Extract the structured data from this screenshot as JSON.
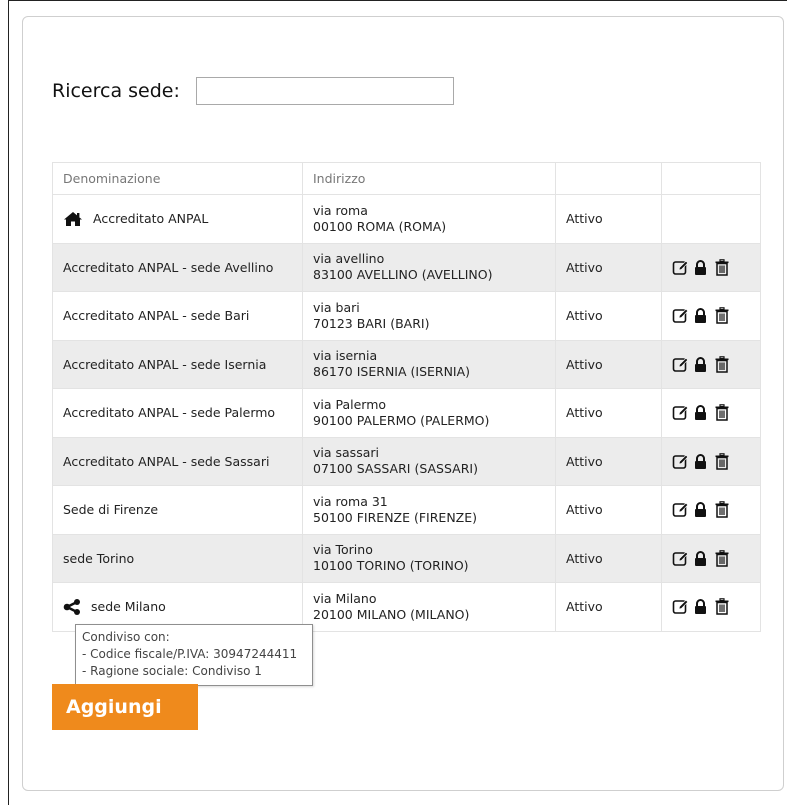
{
  "search": {
    "label": "Ricerca sede:",
    "value": "",
    "placeholder": ""
  },
  "table": {
    "headers": [
      "Denominazione",
      "Indirizzo",
      "",
      ""
    ],
    "rows": [
      {
        "name": "Accreditato ANPAL",
        "icon": "home-icon",
        "street": "via roma",
        "city": "00100 ROMA (ROMA)",
        "status": "Attivo",
        "actions": false
      },
      {
        "name": "Accreditato ANPAL - sede Avellino",
        "icon": "",
        "street": "via avellino",
        "city": "83100 AVELLINO (AVELLINO)",
        "status": "Attivo",
        "actions": true
      },
      {
        "name": "Accreditato ANPAL - sede Bari",
        "icon": "",
        "street": "via bari",
        "city": "70123 BARI (BARI)",
        "status": "Attivo",
        "actions": true
      },
      {
        "name": "Accreditato ANPAL - sede Isernia",
        "icon": "",
        "street": "via isernia",
        "city": "86170 ISERNIA (ISERNIA)",
        "status": "Attivo",
        "actions": true
      },
      {
        "name": "Accreditato ANPAL - sede Palermo",
        "icon": "",
        "street": "via Palermo",
        "city": "90100 PALERMO (PALERMO)",
        "status": "Attivo",
        "actions": true
      },
      {
        "name": "Accreditato ANPAL - sede Sassari",
        "icon": "",
        "street": "via sassari",
        "city": "07100 SASSARI (SASSARI)",
        "status": "Attivo",
        "actions": true
      },
      {
        "name": "Sede di Firenze",
        "icon": "",
        "street": "via roma 31",
        "city": "50100 FIRENZE (FIRENZE)",
        "status": "Attivo",
        "actions": true
      },
      {
        "name": "sede Torino",
        "icon": "",
        "street": "via Torino",
        "city": "10100 TORINO (TORINO)",
        "status": "Attivo",
        "actions": true
      },
      {
        "name": "sede Milano",
        "icon": "share-icon",
        "street": "via Milano",
        "city": "20100 MILANO (MILANO)",
        "status": "Attivo",
        "actions": true
      }
    ],
    "action_icons": [
      "edit-icon",
      "lock-icon",
      "trash-icon"
    ]
  },
  "tooltip": {
    "lines": [
      "Condiviso con:",
      "- Codice fiscale/P.IVA: 30947244411",
      "- Ragione sociale: Condiviso 1"
    ]
  },
  "buttons": {
    "add_label": "Aggiungi"
  },
  "colors": {
    "accent": "#ef8a1c",
    "row_alt": "#ececec",
    "border": "#e3e3e3"
  }
}
